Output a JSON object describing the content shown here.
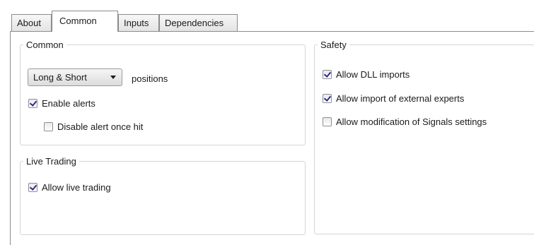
{
  "tabs": [
    {
      "label": "About"
    },
    {
      "label": "Common"
    },
    {
      "label": "Inputs"
    },
    {
      "label": "Dependencies"
    }
  ],
  "active_tab": "Common",
  "common": {
    "title": "Common",
    "position_select": {
      "value": "Long & Short"
    },
    "positions_label": "positions",
    "enable_alerts": {
      "label": "Enable alerts",
      "checked": true
    },
    "disable_alert_once_hit": {
      "label": "Disable alert once hit",
      "checked": false
    }
  },
  "live_trading": {
    "title": "Live Trading",
    "allow_live_trading": {
      "label": "Allow live trading",
      "checked": true
    }
  },
  "safety": {
    "title": "Safety",
    "allow_dll_imports": {
      "label": "Allow DLL imports",
      "checked": true
    },
    "allow_import_external_experts": {
      "label": "Allow import of external experts",
      "checked": true
    },
    "allow_modification_signals": {
      "label": "Allow modification of Signals settings",
      "checked": false
    }
  },
  "icons": {
    "dropdown": "chevron-down-icon",
    "checkbox_checked": "checkmark-icon"
  }
}
